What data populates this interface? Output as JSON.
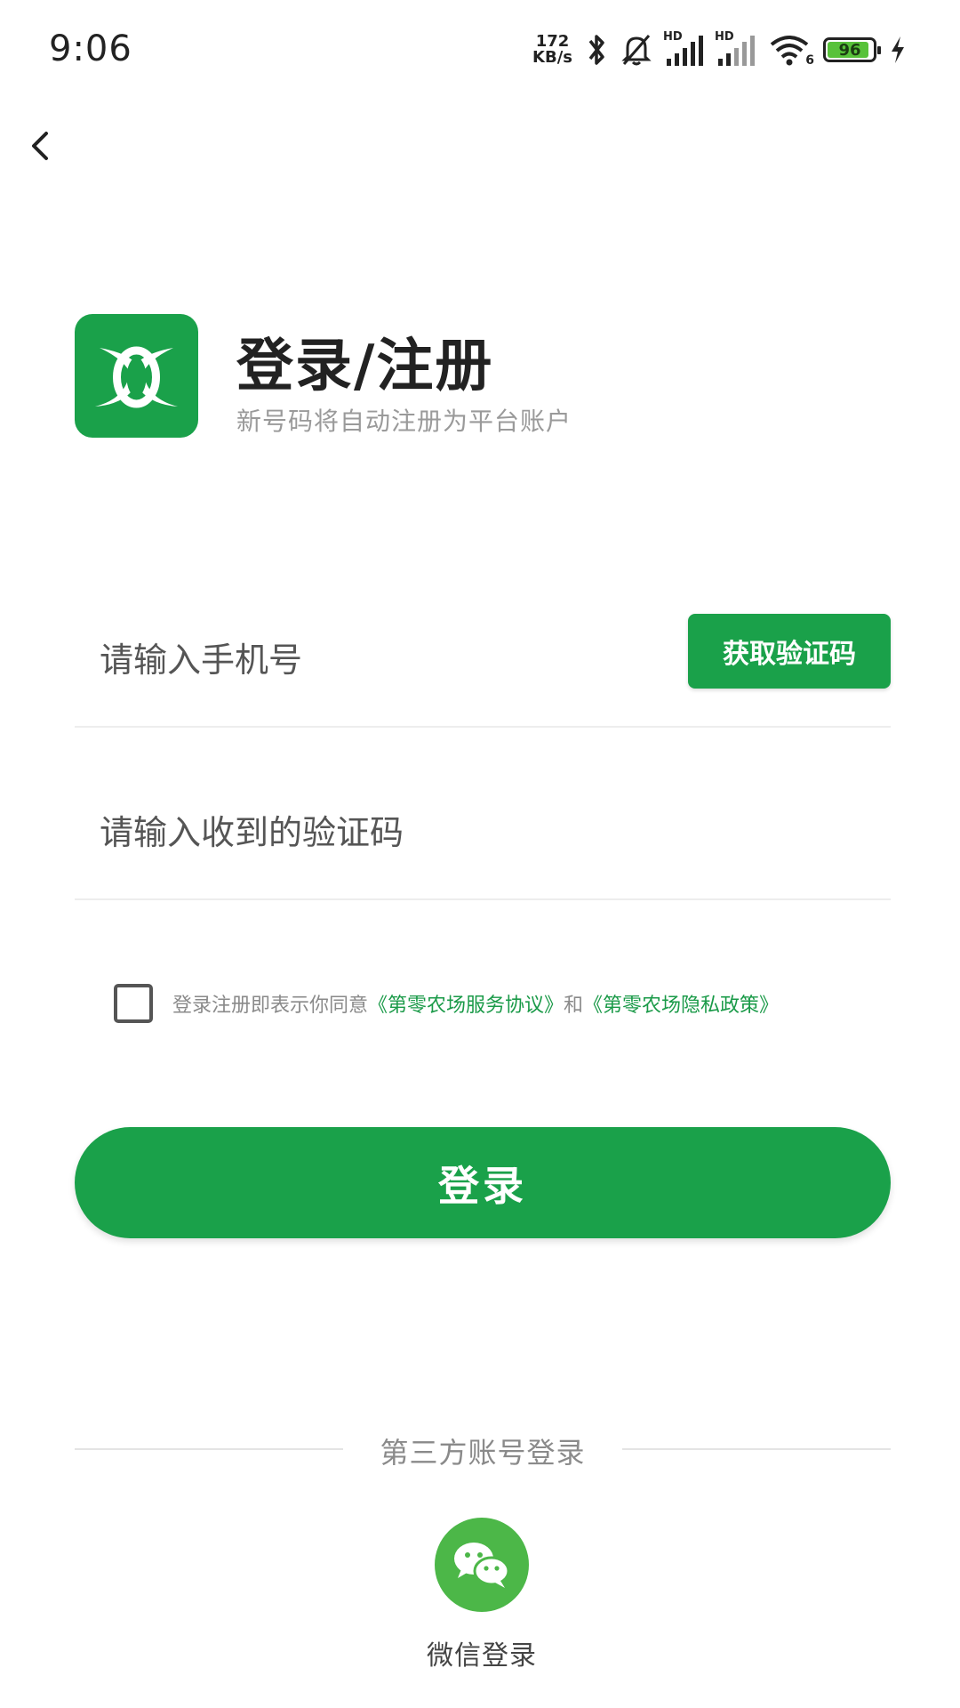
{
  "status_bar": {
    "time": "9:06",
    "net_speed_value": "172",
    "net_speed_unit": "KB/s",
    "hd_label": "HD",
    "wifi_label": "6",
    "battery_level": "96",
    "icons": [
      "bluetooth-icon",
      "bell-muted-icon",
      "signal-icon",
      "signal-icon",
      "wifi-icon",
      "battery-icon",
      "charging-icon"
    ]
  },
  "nav": {
    "back_icon": "chevron-left-icon"
  },
  "header": {
    "logo_icon": "app-logo-icon",
    "title": "登录/注册",
    "subtitle": "新号码将自动注册为平台账户"
  },
  "form": {
    "phone_placeholder": "请输入手机号",
    "sms_button_label": "获取验证码",
    "code_placeholder": "请输入收到的验证码"
  },
  "agreement": {
    "checked": false,
    "prefix": "登录注册即表示你同意",
    "terms_link": "《第零农场服务协议》",
    "joiner": "和",
    "privacy_link": "《第零农场隐私政策》"
  },
  "login_button_label": "登录",
  "third_party": {
    "label": "第三方账号登录",
    "wechat_icon": "wechat-icon",
    "wechat_label": "微信登录"
  },
  "colors": {
    "brand_green": "#1aa14a",
    "link_green": "#1a9a48",
    "wechat_green": "#4cb748"
  }
}
